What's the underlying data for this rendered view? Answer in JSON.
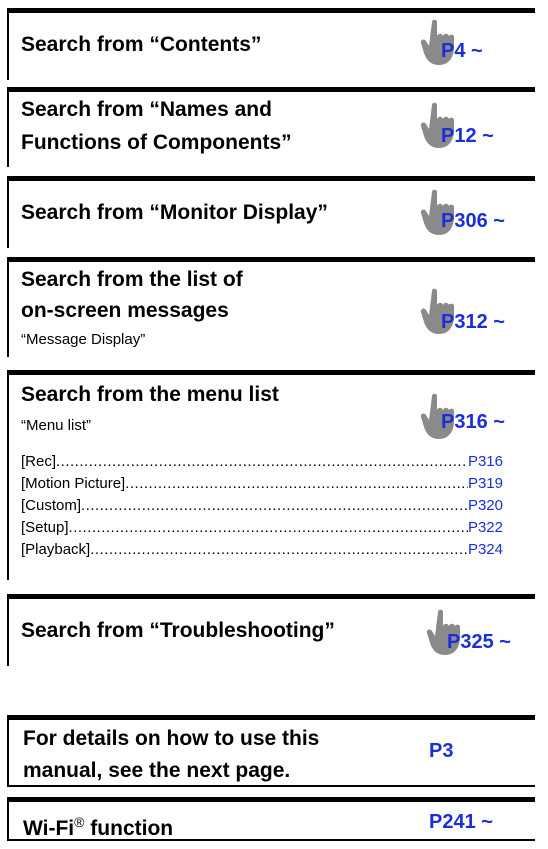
{
  "sections": [
    {
      "title_parts": [
        "Search from ",
        "“Contents”"
      ],
      "pref": "P4 ~"
    },
    {
      "title_line1": "Search from “Names and",
      "title_line2_a": "Functions of Components",
      "title_line2_b": "”",
      "pref": "P12 ~"
    },
    {
      "title_parts": [
        "Search from ",
        "“Monitor Display”"
      ],
      "pref": "P306 ~"
    },
    {
      "title_line1": "Search from the list of",
      "title_line2": "on-screen messages",
      "subtitle": "“Message Display”",
      "pref": "P312 ~"
    },
    {
      "title": "Search from the menu list",
      "subtitle": "“Menu list”",
      "pref": "P316 ~",
      "menu": [
        {
          "label": "[Rec]",
          "page": "P316"
        },
        {
          "label": "[Motion Picture]",
          "page": "P319"
        },
        {
          "label": "[Custom]",
          "page": "P320"
        },
        {
          "label": "[Setup]",
          "page": "P322"
        },
        {
          "label": "[Playback]",
          "page": "P324"
        }
      ]
    },
    {
      "title_parts": [
        "Search from ",
        "“Troubleshooting”"
      ],
      "pref": "P325 ~"
    }
  ],
  "details_box": {
    "line1": "For details on how to use this",
    "line2": "manual, see the next page.",
    "pref": "P3"
  },
  "wifi_box": {
    "label": "Wi-Fi",
    "registered": "®",
    "label_rest": " function",
    "pref": "P241 ~"
  },
  "colors": {
    "link": "#1a2fd6",
    "hand": "#8a8a8a"
  }
}
